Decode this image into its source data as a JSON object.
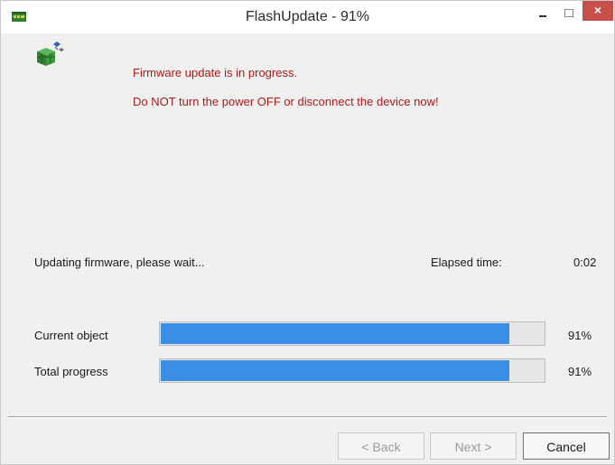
{
  "window": {
    "title": "FlashUpdate - 91%",
    "close_glyph": "×"
  },
  "icons": {
    "app": "flash-chip-icon",
    "package": "package-cubes-icon"
  },
  "warning": {
    "line1": "Firmware update is in progress.",
    "line2": "Do NOT turn the power OFF or disconnect the device now!"
  },
  "status": {
    "text": "Updating firmware, please wait...",
    "elapsed_label": "Elapsed time:",
    "elapsed_value": "0:02"
  },
  "progress": {
    "current_label": "Current object",
    "current_value": 91,
    "current_pct": "91%",
    "total_label": "Total progress",
    "total_value": 91,
    "total_pct": "91%"
  },
  "buttons": {
    "back": "< Back",
    "next": "Next >",
    "cancel": "Cancel"
  },
  "colors": {
    "warning_text": "#b01818",
    "progress_fill": "#3a8ee6",
    "close_button": "#c7504b"
  }
}
